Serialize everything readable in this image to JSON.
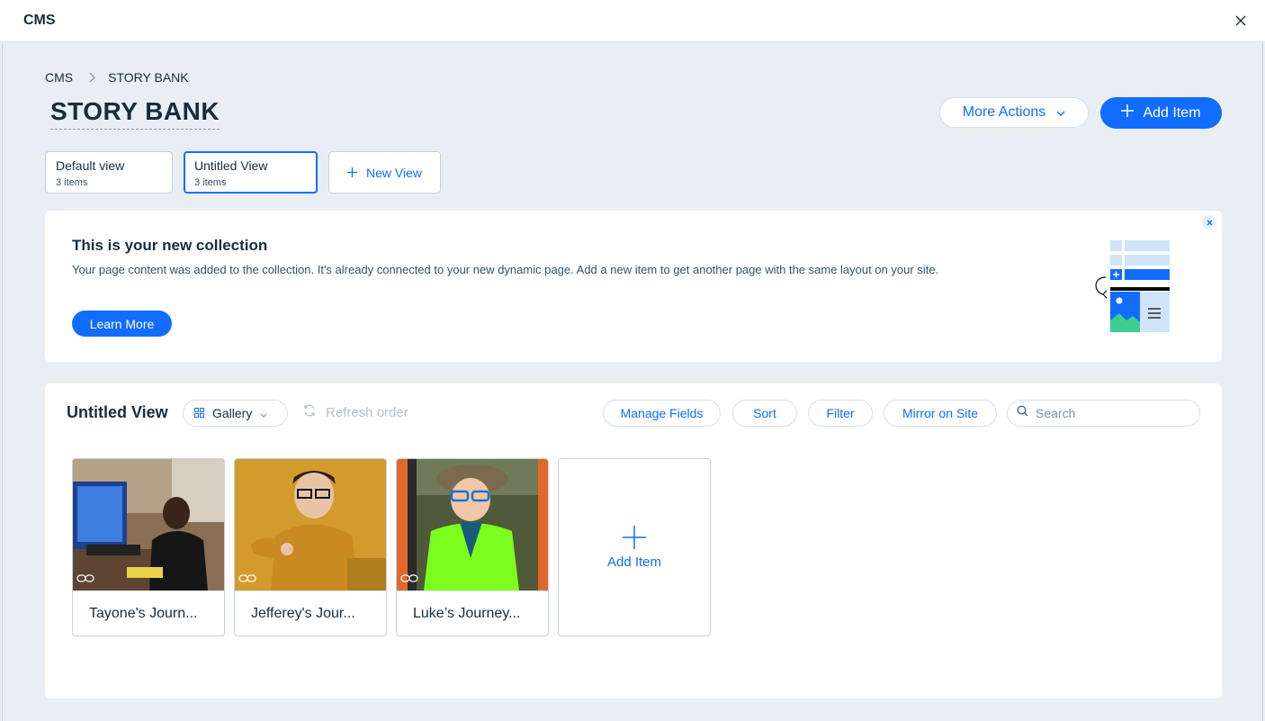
{
  "app": {
    "title": "CMS"
  },
  "breadcrumb": {
    "root": "CMS",
    "current": "STORY BANK"
  },
  "page": {
    "title": "STORY BANK"
  },
  "actions": {
    "more_actions": "More Actions",
    "add_item": "Add Item"
  },
  "views": [
    {
      "name": "Default view",
      "count": "3 items",
      "active": false
    },
    {
      "name": "Untitled View",
      "count": "3 items",
      "active": true
    }
  ],
  "new_view": "New View",
  "banner": {
    "title": "This is your new collection",
    "text": "Your page content was added to the collection. It's already connected to your new dynamic page. Add a new item to get another page with the same layout on your site.",
    "learn_more": "Learn More"
  },
  "panel": {
    "title": "Untitled View",
    "layout_select": "Gallery",
    "refresh_order": "Refresh order",
    "manage_fields": "Manage Fields",
    "sort": "Sort",
    "filter": "Filter",
    "mirror": "Mirror on Site",
    "search_placeholder": "Search",
    "items": [
      {
        "label": "Tayone's Journ..."
      },
      {
        "label": "Jefferey's Jour..."
      },
      {
        "label": "Luke’s Journey..."
      }
    ],
    "add_item": "Add Item"
  },
  "colors": {
    "accent": "#116dff",
    "text": "#162d3d",
    "background": "#e9eef5"
  }
}
